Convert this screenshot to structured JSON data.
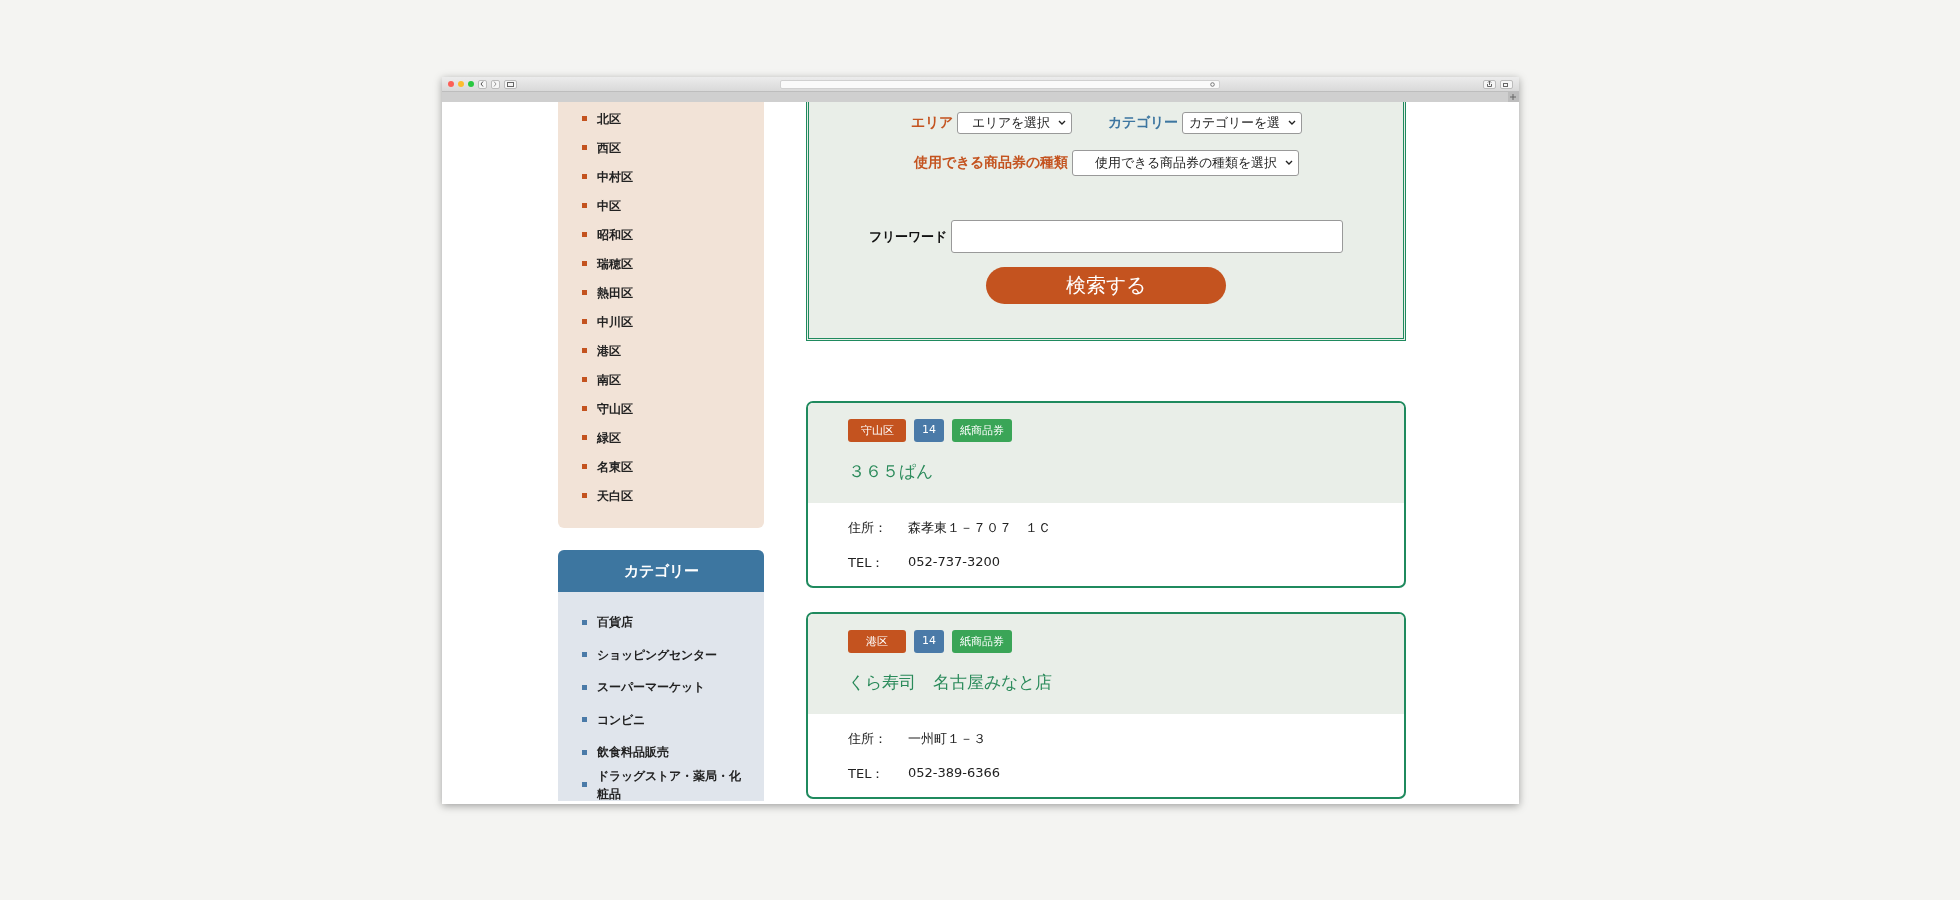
{
  "sidebar": {
    "areas": [
      "北区",
      "西区",
      "中村区",
      "中区",
      "昭和区",
      "瑞穂区",
      "熱田区",
      "中川区",
      "港区",
      "南区",
      "守山区",
      "緑区",
      "名東区",
      "天白区"
    ],
    "category": {
      "title": "カテゴリー",
      "items": [
        "百貨店",
        "ショッピングセンター",
        "スーパーマーケット",
        "コンビニ",
        "飲食料品販売",
        "ドラッグストア・薬局・化粧品"
      ]
    }
  },
  "search_form": {
    "rows": [
      [
        {
          "label": "エリア",
          "color": "#c4531f",
          "kind": "select",
          "value": "エリアを選択"
        },
        {
          "label": "カテゴリー",
          "color": "#3d76a0",
          "kind": "select",
          "value": "カテゴリーを選"
        }
      ],
      [
        {
          "label": "使用できる商品券の種類",
          "color": "#c4531f",
          "kind": "select",
          "value": "使用できる商品券の種類を選択"
        }
      ],
      [
        {
          "label": "フリーワード",
          "color": "#111111",
          "kind": "text"
        }
      ]
    ],
    "button": "検索する"
  },
  "results": [
    {
      "tags": [
        {
          "text": "守山区",
          "color": "#c4531f"
        },
        {
          "text": "14",
          "color": "#4a7aa8"
        },
        {
          "text": "紙商品券",
          "color": "#3aa557"
        }
      ],
      "name": "３６５ぱん",
      "address_label": "住所：",
      "address": "森孝東１－７０７　１Ｃ",
      "tel_label": "TEL：",
      "tel": "052-737-3200"
    },
    {
      "tags": [
        {
          "text": "港区",
          "color": "#c4531f"
        },
        {
          "text": "14",
          "color": "#4a7aa8"
        },
        {
          "text": "紙商品券",
          "color": "#3aa557"
        }
      ],
      "name": "くら寿司　名古屋みなと店",
      "address_label": "住所：",
      "address": "一州町１－３",
      "tel_label": "TEL：",
      "tel": "052-389-6366"
    }
  ]
}
